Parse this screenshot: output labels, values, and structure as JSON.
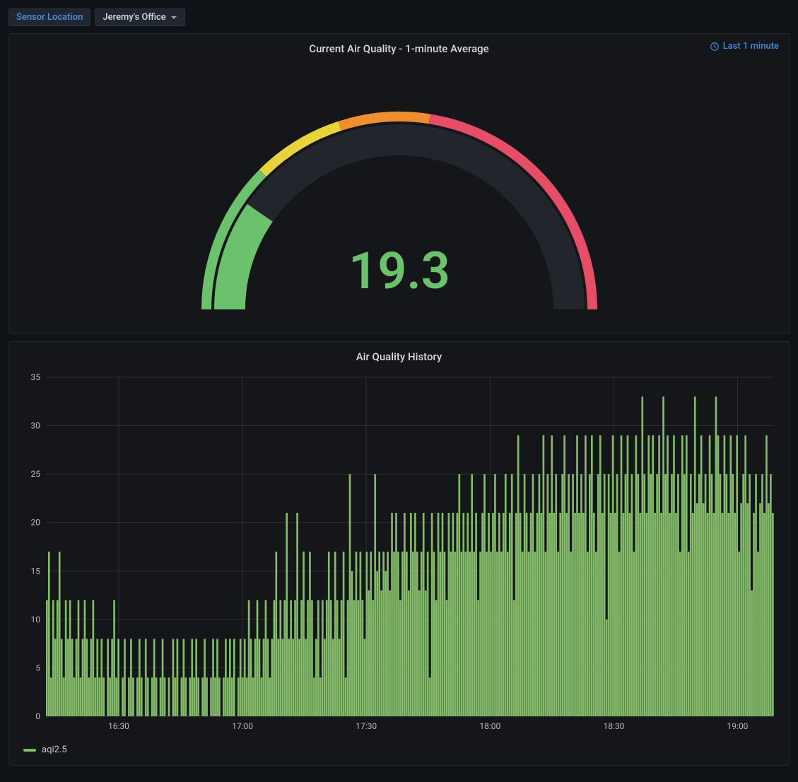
{
  "filter": {
    "label": "Sensor Location",
    "selected": "Jeremy's Office"
  },
  "gauge_panel": {
    "title": "Current Air Quality - 1-minute Average",
    "timerange_label": "Last 1 minute",
    "value_text": "19.3",
    "value": 19.3,
    "min": 0,
    "max": 100,
    "thresholds": [
      {
        "from": 0,
        "to": 25,
        "color": "#6cc26c"
      },
      {
        "from": 25,
        "to": 40,
        "color": "#e8d33a"
      },
      {
        "from": 40,
        "to": 55,
        "color": "#ef8e2f"
      },
      {
        "from": 55,
        "to": 100,
        "color": "#e64d67"
      }
    ]
  },
  "history_panel": {
    "title": "Air Quality History",
    "legend_label": "aqi2.5"
  },
  "chart_data": {
    "type": "bar",
    "title": "Air Quality History",
    "xlabel": "",
    "ylabel": "",
    "ylim": [
      0,
      35
    ],
    "y_ticks": [
      0,
      5,
      10,
      15,
      20,
      25,
      30,
      35
    ],
    "x_ticks": [
      "16:30",
      "17:00",
      "17:30",
      "18:00",
      "18:30",
      "19:00"
    ],
    "series": [
      {
        "name": "aqi2.5",
        "approximate": true,
        "sample_interval_seconds": 30,
        "note": "Values estimated from chart pixels; high-frequency noisy series",
        "values": [
          12,
          17,
          4,
          12,
          8,
          12,
          17,
          8,
          4,
          12,
          8,
          12,
          8,
          4,
          8,
          12,
          4,
          8,
          12,
          8,
          4,
          8,
          12,
          4,
          8,
          4,
          8,
          4,
          0,
          8,
          4,
          8,
          12,
          4,
          8,
          0,
          4,
          8,
          0,
          4,
          8,
          4,
          0,
          4,
          8,
          4,
          0,
          8,
          4,
          0,
          4,
          8,
          4,
          0,
          4,
          8,
          4,
          0,
          4,
          0,
          8,
          4,
          8,
          0,
          4,
          8,
          4,
          0,
          4,
          8,
          4,
          8,
          4,
          0,
          4,
          8,
          4,
          0,
          4,
          8,
          4,
          8,
          4,
          0,
          4,
          8,
          4,
          8,
          4,
          8,
          0,
          4,
          8,
          4,
          8,
          4,
          12,
          8,
          4,
          8,
          12,
          8,
          4,
          8,
          12,
          8,
          4,
          8,
          12,
          17,
          8,
          12,
          8,
          12,
          21,
          8,
          12,
          8,
          12,
          21,
          8,
          12,
          17,
          8,
          12,
          17,
          12,
          4,
          8,
          12,
          4,
          12,
          8,
          12,
          17,
          12,
          8,
          17,
          12,
          8,
          12,
          17,
          4,
          12,
          25,
          15,
          12,
          17,
          12,
          17,
          12,
          8,
          17,
          13,
          17,
          12,
          25,
          15,
          17,
          13,
          17,
          15,
          17,
          13,
          21,
          17,
          21,
          17,
          12,
          17,
          21,
          17,
          13,
          21,
          17,
          21,
          17,
          13,
          17,
          21,
          13,
          17,
          4,
          21,
          17,
          12,
          21,
          17,
          21,
          17,
          12,
          21,
          17,
          21,
          17,
          21,
          25,
          17,
          21,
          17,
          21,
          17,
          25,
          17,
          21,
          12,
          17,
          21,
          25,
          17,
          21,
          17,
          21,
          25,
          17,
          21,
          17,
          21,
          25,
          17,
          21,
          25,
          12,
          21,
          29,
          21,
          17,
          25,
          21,
          17,
          21,
          25,
          17,
          21,
          25,
          21,
          29,
          17,
          25,
          21,
          29,
          21,
          25,
          17,
          21,
          25,
          29,
          21,
          25,
          17,
          25,
          21,
          29,
          21,
          25,
          21,
          29,
          17,
          25,
          29,
          21,
          17,
          25,
          29,
          21,
          25,
          10,
          25,
          21,
          29,
          21,
          25,
          17,
          29,
          21,
          25,
          29,
          21,
          25,
          17,
          29,
          25,
          21,
          33,
          25,
          21,
          29,
          25,
          29,
          21,
          25,
          29,
          21,
          33,
          25,
          29,
          21,
          25,
          29,
          21,
          25,
          17,
          29,
          25,
          29,
          17,
          25,
          21,
          33,
          22,
          25,
          29,
          22,
          25,
          21,
          29,
          25,
          21,
          33,
          29,
          25,
          21,
          29,
          25,
          21,
          29,
          25,
          21,
          29,
          17,
          22,
          25,
          29,
          22,
          25,
          13,
          21,
          25,
          17,
          22,
          25,
          21,
          29,
          22,
          25,
          21
        ]
      }
    ]
  }
}
